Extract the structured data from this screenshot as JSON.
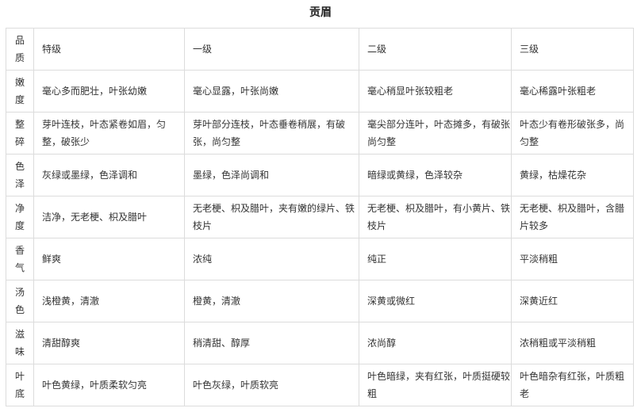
{
  "title": "贡眉",
  "table": {
    "header": {
      "label": "品质",
      "grades": [
        "特级",
        "一级",
        "二级",
        "三级"
      ]
    },
    "rows": [
      {
        "label": "嫩度",
        "cells": [
          "毫心多而肥壮，叶张幼嫩",
          "毫心显露，叶张尚嫩",
          "毫心稍显叶张较粗老",
          "毫心稀露叶张粗老"
        ]
      },
      {
        "label": "整碎",
        "cells": [
          "芽叶连枝，叶态紧卷如眉，匀整，破张少",
          "芽叶部分连枝，叶态垂卷稍展，有破张，尚匀整",
          "毫尖部分连叶，叶态摊多，有破张尚匀整",
          "叶态少有卷形破张多，尚匀整"
        ]
      },
      {
        "label": "色泽",
        "cells": [
          "灰绿或墨绿，色泽调和",
          "墨绿，色泽尚调和",
          "暗绿或黄绿，色泽较杂",
          "黄绿，枯燥花杂"
        ]
      },
      {
        "label": "净度",
        "cells": [
          "洁净，无老梗、枳及腊叶",
          "无老梗、枳及腊叶，夹有嫩的绿片、铁枝片",
          "无老梗、枳及腊叶，有小黄片、铁枝片",
          "无老梗、枳及腊叶，含腊片较多"
        ]
      },
      {
        "label": "香气",
        "cells": [
          "鲜爽",
          "浓纯",
          "纯正",
          "平淡稍粗"
        ]
      },
      {
        "label": "汤色",
        "cells": [
          "浅橙黄，清澈",
          "橙黄，清澈",
          "深黄或微红",
          "深黄近红"
        ]
      },
      {
        "label": "滋味",
        "cells": [
          "清甜醇爽",
          "稍清甜、醇厚",
          "浓尚醇",
          "浓稍粗或平淡稍粗"
        ]
      },
      {
        "label": "叶底",
        "cells": [
          "叶色黄绿，叶质柔软匀亮",
          "叶色灰绿，叶质软亮",
          "叶色暗绿，夹有红张，叶质挺硬较粗",
          "叶色暗杂有红张，叶质粗老"
        ]
      }
    ]
  }
}
